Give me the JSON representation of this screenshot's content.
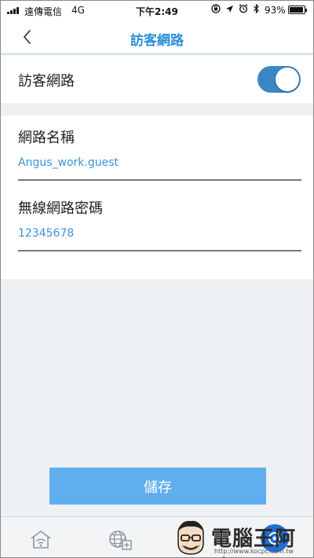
{
  "status_bar": {
    "carrier": "遠傳電信",
    "network": "4G",
    "time": "下午2:49",
    "battery_percent": "93%",
    "battery_level": 0.93,
    "icons": [
      "orientation-lock-icon",
      "location-icon",
      "alarm-icon",
      "bluetooth-icon"
    ]
  },
  "header": {
    "back_icon": "chevron-left-icon",
    "title": "訪客網路"
  },
  "guest_network_toggle": {
    "label": "訪客網路",
    "state": "on",
    "color": "#3a87c8"
  },
  "form": {
    "ssid": {
      "label": "網路名稱",
      "value": "Angus_work.guest"
    },
    "password": {
      "label": "無線網路密碼",
      "value": "12345678"
    }
  },
  "save_button": {
    "label": "儲存",
    "color": "#60aeee"
  },
  "tab_bar": {
    "tabs": [
      {
        "icon": "wifi-home-icon"
      },
      {
        "icon": "globe-add-icon"
      },
      {
        "icon": "settings-icon",
        "active": true
      }
    ]
  },
  "watermark": {
    "text": "電腦王阿達",
    "url": "http://www.kocpc.com.tw"
  },
  "colors": {
    "accent": "#2a8fd8",
    "link_value": "#3b93d6",
    "page_background": "#eef1f4"
  }
}
